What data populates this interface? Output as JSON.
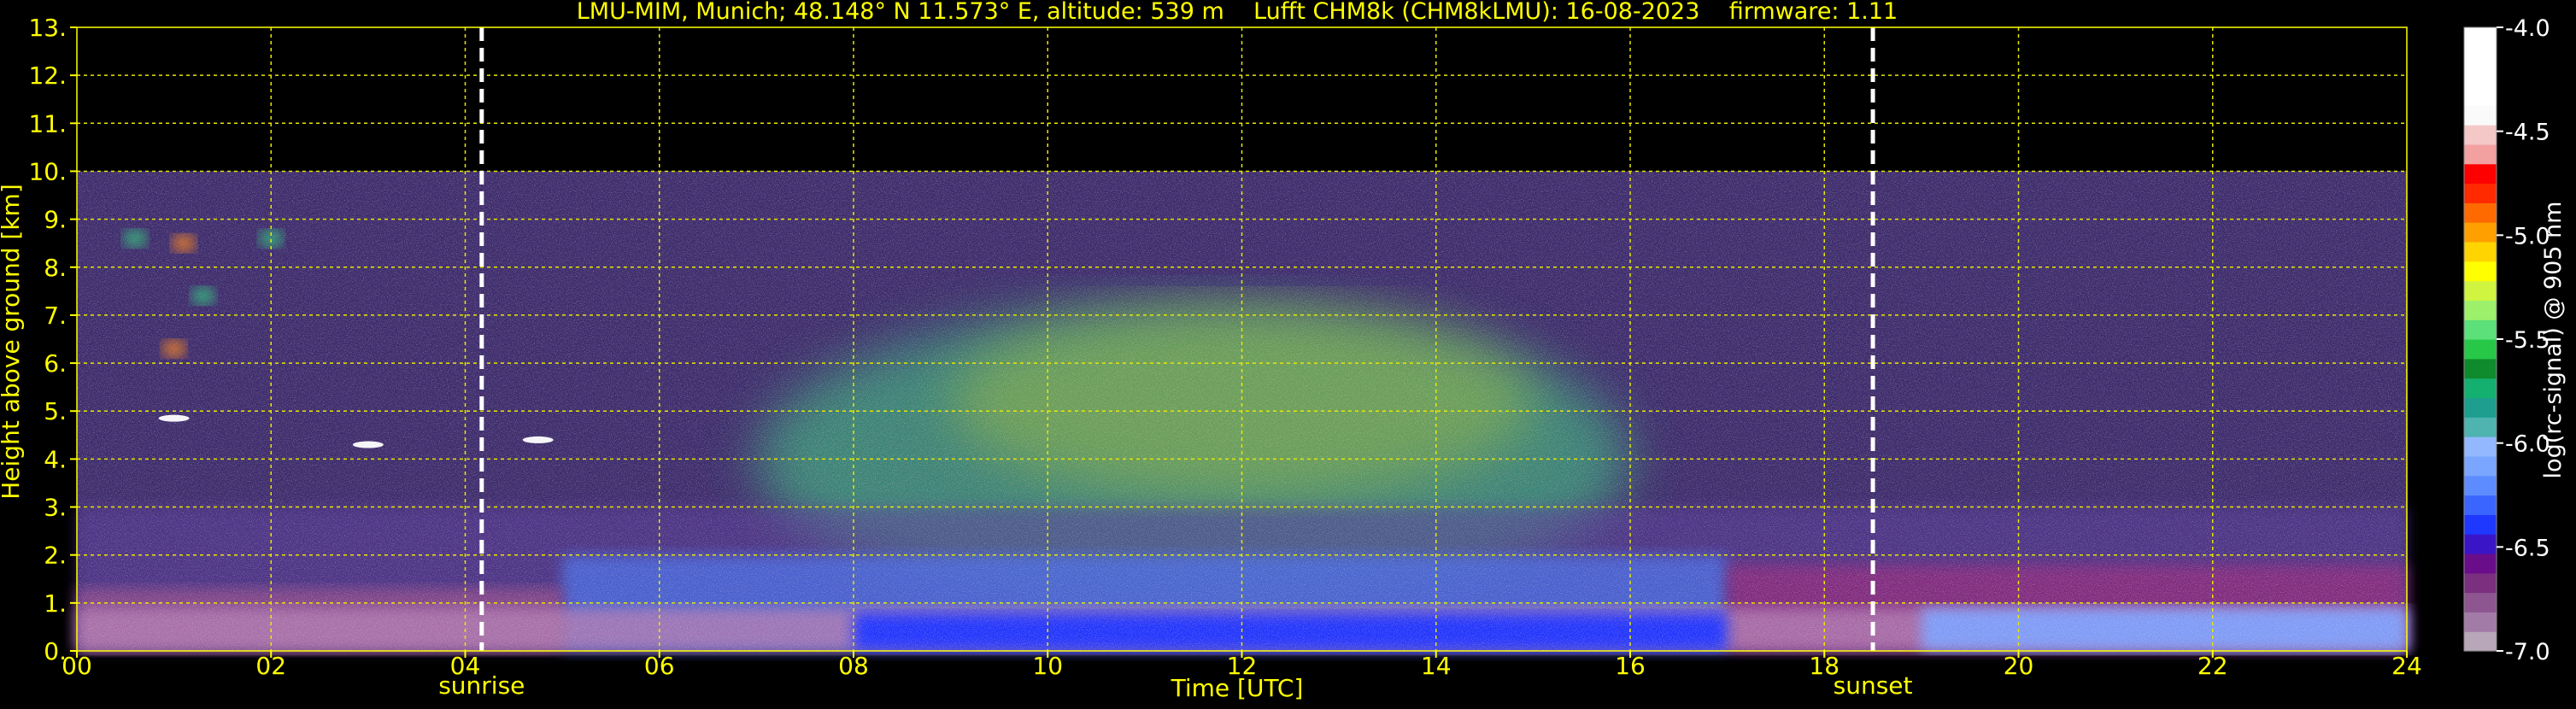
{
  "chart_data": {
    "type": "heatmap",
    "title": "LMU-MIM, Munich; 48.148° N 11.573° E, altitude: 539 m    Lufft CHM8k (CHM8kLMU): 16-08-2023    firmware: 1.11",
    "xlabel": "Time [UTC]",
    "ylabel": "Height above ground [km]",
    "xlim": [
      0,
      24
    ],
    "ylim": [
      0,
      13
    ],
    "x_ticks": [
      0,
      2,
      4,
      6,
      8,
      10,
      12,
      14,
      16,
      18,
      20,
      22,
      24
    ],
    "x_tick_labels": [
      "00",
      "02",
      "04",
      "06",
      "08",
      "10",
      "12",
      "14",
      "16",
      "18",
      "20",
      "22",
      "24"
    ],
    "y_ticks": [
      0,
      1,
      2,
      3,
      4,
      5,
      6,
      7,
      8,
      9,
      10,
      11,
      12,
      13
    ],
    "y_tick_labels": [
      "0.",
      "1.",
      "2.",
      "3.",
      "4.",
      "5.",
      "6.",
      "7.",
      "8.",
      "9.",
      "10.",
      "11.",
      "12.",
      "13."
    ],
    "grid": true,
    "data_max_height_km": 10,
    "events": [
      {
        "label": "sunrise",
        "time": 4.17
      },
      {
        "label": "sunset",
        "time": 18.5
      }
    ],
    "colorbar": {
      "label": "log(rc-signal) @ 905 nm",
      "range": [
        -7.0,
        -4.0
      ],
      "ticks": [
        -4.0,
        -4.5,
        -5.0,
        -5.5,
        -6.0,
        -6.5,
        -7.0
      ],
      "tick_labels": [
        "-4.0",
        "-4.5",
        "-5.0",
        "-5.5",
        "-6.0",
        "-6.5",
        "-7.0"
      ],
      "colors_low_to_high": [
        "#b8a6b9",
        "#a27ca6",
        "#8d5691",
        "#7a2f7f",
        "#6a0d8a",
        "#3a15c8",
        "#1f38ff",
        "#3a66ff",
        "#5c8cff",
        "#7aa6ff",
        "#93b8ff",
        "#4fb3b0",
        "#1d9e8e",
        "#14b070",
        "#0f8a2c",
        "#27c848",
        "#5ce07a",
        "#9cf06a",
        "#d0f540",
        "#ffff00",
        "#ffd400",
        "#ffa000",
        "#ff6a00",
        "#ff2a00",
        "#ff0000",
        "#f2a0a0",
        "#f5c8c8",
        "#fafafa",
        "#ffffff",
        "#ffffff",
        "#ffffff",
        "#ffffff"
      ]
    }
  }
}
